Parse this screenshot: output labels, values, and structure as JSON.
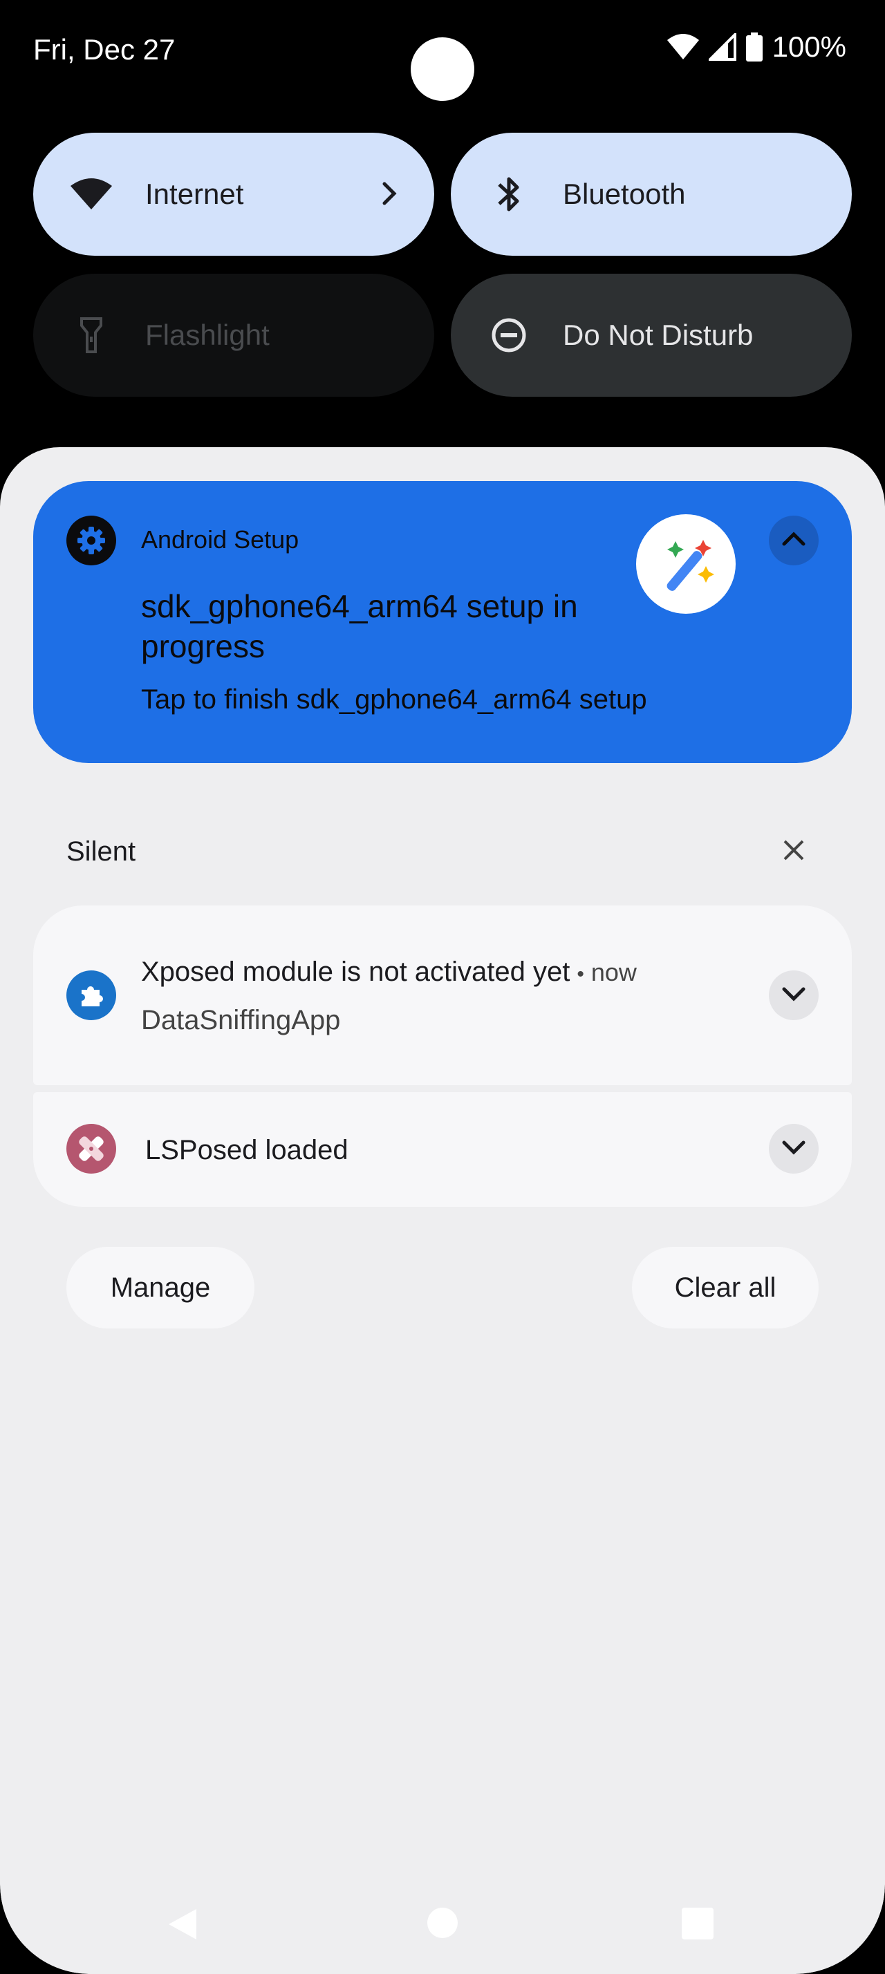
{
  "status_bar": {
    "date": "Fri, Dec 27",
    "battery": "100%"
  },
  "quick_settings": {
    "tiles": [
      {
        "label": "Internet",
        "icon": "wifi-icon",
        "state": "on"
      },
      {
        "label": "Bluetooth",
        "icon": "bluetooth-icon",
        "state": "on"
      },
      {
        "label": "Flashlight",
        "icon": "flashlight-icon",
        "state": "unavailable"
      },
      {
        "label": "Do Not Disturb",
        "icon": "do-not-disturb-icon",
        "state": "off"
      }
    ]
  },
  "setup_notification": {
    "app_name": "Android Setup",
    "title": "sdk_gphone64_arm64 setup in progress",
    "text": "Tap to finish sdk_gphone64_arm64 setup",
    "icon": "gear-icon",
    "large_icon": "magic-wand-icon"
  },
  "silent_section": {
    "header": "Silent",
    "notifications": [
      {
        "title": "Xposed module is not activated yet",
        "time": "now",
        "subtitle": "DataSniffingApp",
        "icon": "puzzle-icon"
      },
      {
        "title": "LSPosed loaded",
        "icon": "bandage-icon"
      }
    ]
  },
  "actions": {
    "manage": "Manage",
    "clear_all": "Clear all"
  },
  "colors": {
    "tile_on": "#d3e2fb",
    "setup_bg": "#1e6fe6",
    "shade_bg": "#eeeef0"
  }
}
